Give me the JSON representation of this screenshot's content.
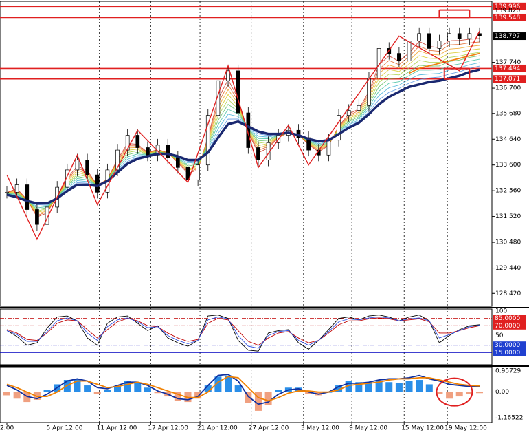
{
  "chart_data": [
    {
      "panel": "price",
      "type": "line",
      "ylim": [
        127.9,
        140.2
      ],
      "y_ticks": [
        128.42,
        129.44,
        130.48,
        131.52,
        132.56,
        133.6,
        134.64,
        135.68,
        136.7,
        137.74
      ],
      "y_tick_labels": [
        "128.420",
        "129.440",
        "130.480",
        "131.520",
        "132.560",
        "133.600",
        "134.640",
        "135.680",
        "136.700",
        "137.740"
      ],
      "price_tags": [
        {
          "label": "139.996",
          "value": 139.996,
          "style": "red"
        },
        {
          "label": "139.820",
          "value": 139.82,
          "style": "partial"
        },
        {
          "label": "139.548",
          "value": 139.548,
          "style": "red"
        },
        {
          "label": "138.797",
          "value": 138.797,
          "style": "black"
        },
        {
          "label": "137.494",
          "value": 137.494,
          "style": "red"
        },
        {
          "label": "137.071",
          "value": 137.071,
          "style": "red"
        }
      ],
      "x_range": [
        0,
        47
      ],
      "series": [
        {
          "key": "close",
          "color": "#000000",
          "x": [
            0,
            1,
            2,
            3,
            4,
            5,
            6,
            7,
            8,
            9,
            10,
            11,
            12,
            13,
            14,
            15,
            16,
            17,
            18,
            19,
            20,
            21,
            22,
            23,
            24,
            25,
            26,
            27,
            28,
            29,
            30,
            31,
            32,
            33,
            34,
            35,
            36,
            37,
            38,
            39,
            40,
            41,
            42,
            43,
            44,
            45,
            46,
            47
          ],
          "values": [
            132.5,
            132.8,
            131.8,
            131.2,
            131.9,
            132.7,
            133.4,
            133.8,
            133.2,
            132.5,
            133.4,
            134.2,
            134.8,
            134.3,
            134.0,
            134.4,
            133.9,
            133.5,
            133.0,
            133.6,
            135.6,
            137.0,
            137.4,
            135.7,
            134.3,
            133.8,
            134.5,
            134.8,
            135.0,
            134.7,
            134.2,
            134.0,
            134.6,
            135.6,
            135.8,
            136.0,
            137.1,
            138.3,
            138.1,
            137.8,
            138.6,
            138.9,
            138.3,
            138.6,
            138.9,
            138.7,
            138.9,
            138.8
          ]
        },
        {
          "key": "ma_slow",
          "color": "#1a2870",
          "x": [
            0,
            1,
            2,
            3,
            4,
            5,
            6,
            7,
            8,
            9,
            10,
            11,
            12,
            13,
            14,
            15,
            16,
            17,
            18,
            19,
            20,
            21,
            22,
            23,
            24,
            25,
            26,
            27,
            28,
            29,
            30,
            31,
            32,
            33,
            34,
            35,
            36,
            37,
            38,
            39,
            40,
            41,
            42,
            43,
            44,
            45,
            46,
            47
          ],
          "values": [
            132.4,
            132.3,
            132.15,
            132.05,
            132.05,
            132.25,
            132.55,
            132.8,
            132.8,
            132.75,
            132.95,
            133.3,
            133.65,
            133.85,
            133.95,
            134.05,
            134.05,
            133.95,
            133.8,
            133.8,
            134.1,
            134.7,
            135.25,
            135.35,
            135.15,
            134.95,
            134.85,
            134.85,
            134.9,
            134.8,
            134.65,
            134.55,
            134.6,
            134.85,
            135.1,
            135.3,
            135.65,
            136.05,
            136.35,
            136.55,
            136.75,
            136.85,
            136.95,
            137.0,
            137.1,
            137.2,
            137.35,
            137.45
          ]
        },
        {
          "key": "ma_orange",
          "color": "#f08010",
          "x": [
            40,
            41,
            42,
            43,
            44,
            45,
            46,
            47
          ],
          "values": [
            137.3,
            137.5,
            137.6,
            137.7,
            137.8,
            137.9,
            138.0,
            138.1
          ]
        }
      ],
      "band_colors": [
        "#c83020",
        "#e06020",
        "#f0a020",
        "#d8c820",
        "#a8d040",
        "#60c060",
        "#40c0a0",
        "#40b0d8",
        "#5090e0"
      ],
      "zigzag_points": {
        "x": [
          0,
          3,
          7,
          9,
          13,
          18,
          22,
          25,
          28,
          30,
          39,
          45,
          47
        ],
        "values": [
          133.2,
          130.6,
          134.0,
          132.0,
          135.0,
          132.9,
          137.6,
          133.5,
          135.2,
          133.6,
          138.8,
          137.4,
          139.0
        ]
      },
      "annotation_boxes": [
        {
          "x_from": 43,
          "x_to": 46,
          "y_from": 139.55,
          "y_to": 139.85
        },
        {
          "x_from": 43.5,
          "x_to": 46,
          "y_from": 137.07,
          "y_to": 137.49
        }
      ],
      "x_tick_labels": [
        "2:00",
        "5 Apr 12:00",
        "11 Apr 12:00",
        "17 Apr 12:00",
        "21 Apr 12:00",
        "27 Apr 12:00",
        "3 May 12:00",
        "9 May 12:00",
        "15 May 12:00",
        "19 May 12:00"
      ],
      "x_tick_positions": [
        0,
        4.2,
        9.2,
        14.3,
        19.2,
        24.3,
        29.5,
        34.3,
        39.5,
        43.8
      ]
    },
    {
      "panel": "stochastic",
      "type": "line",
      "ylim": [
        0,
        100
      ],
      "y_ticks": [
        100,
        85,
        70,
        50,
        30,
        15
      ],
      "y_tick_labels": [
        "100",
        "85.0000",
        "70.0000",
        "50",
        "30.0000",
        "15.0000"
      ],
      "levels": [
        {
          "value": 85,
          "color": "#c00000",
          "style": "dashdot"
        },
        {
          "value": 70,
          "color": "#c00000",
          "style": "dashdot"
        },
        {
          "value": 30,
          "color": "#0000c0",
          "style": "dashdot"
        },
        {
          "value": 15,
          "color": "#0000c0",
          "style": "solid"
        }
      ],
      "series": [
        {
          "key": "main",
          "color": "#000000",
          "x": [
            0,
            1,
            2,
            3,
            4,
            5,
            6,
            7,
            8,
            9,
            10,
            11,
            12,
            13,
            14,
            15,
            16,
            17,
            18,
            19,
            20,
            21,
            22,
            23,
            24,
            25,
            26,
            27,
            28,
            29,
            30,
            31,
            32,
            33,
            34,
            35,
            36,
            37,
            38,
            39,
            40,
            41,
            42,
            43,
            44,
            45,
            46,
            47
          ],
          "values": [
            60,
            48,
            30,
            35,
            65,
            88,
            90,
            80,
            45,
            30,
            75,
            88,
            90,
            75,
            60,
            70,
            45,
            35,
            28,
            40,
            90,
            92,
            85,
            40,
            20,
            18,
            55,
            60,
            62,
            35,
            22,
            40,
            62,
            85,
            88,
            82,
            90,
            92,
            88,
            80,
            88,
            92,
            80,
            35,
            50,
            62,
            70,
            72
          ]
        },
        {
          "key": "signal",
          "color": "#c00000",
          "x": [
            0,
            1,
            2,
            3,
            4,
            5,
            6,
            7,
            8,
            9,
            10,
            11,
            12,
            13,
            14,
            15,
            16,
            17,
            18,
            19,
            20,
            21,
            22,
            23,
            24,
            25,
            26,
            27,
            28,
            29,
            30,
            31,
            32,
            33,
            34,
            35,
            36,
            37,
            38,
            39,
            40,
            41,
            42,
            43,
            44,
            45,
            46,
            47
          ],
          "values": [
            62,
            55,
            42,
            40,
            55,
            75,
            82,
            80,
            62,
            45,
            62,
            78,
            85,
            80,
            70,
            68,
            55,
            45,
            38,
            42,
            75,
            85,
            82,
            60,
            38,
            30,
            45,
            55,
            58,
            45,
            35,
            40,
            55,
            72,
            80,
            80,
            84,
            86,
            84,
            80,
            82,
            84,
            78,
            55,
            55,
            60,
            66,
            70
          ]
        },
        {
          "key": "extra",
          "color": "#3050e0",
          "x": [
            0,
            1,
            2,
            3,
            4,
            5,
            6,
            7,
            8,
            9,
            10,
            11,
            12,
            13,
            14,
            15,
            16,
            17,
            18,
            19,
            20,
            21,
            22,
            23,
            24,
            25,
            26,
            27,
            28,
            29,
            30,
            31,
            32,
            33,
            34,
            35,
            36,
            37,
            38,
            39,
            40,
            41,
            42,
            43,
            44,
            45,
            46,
            47
          ],
          "values": [
            60,
            52,
            38,
            38,
            58,
            80,
            86,
            80,
            55,
            40,
            68,
            82,
            86,
            78,
            66,
            68,
            50,
            40,
            33,
            40,
            82,
            88,
            84,
            50,
            28,
            24,
            50,
            58,
            60,
            40,
            30,
            40,
            58,
            78,
            84,
            82,
            86,
            88,
            86,
            80,
            84,
            86,
            80,
            45,
            52,
            60,
            68,
            71
          ]
        }
      ]
    },
    {
      "panel": "oscillator",
      "type": "bar",
      "ylim": [
        -1.16522,
        0.95729
      ],
      "y_ticks": [
        0.95729,
        0.0,
        -1.16522
      ],
      "y_tick_labels": [
        "0.95729",
        "0.00",
        "-1.16522"
      ],
      "histogram": {
        "x": [
          0,
          1,
          2,
          3,
          4,
          5,
          6,
          7,
          8,
          9,
          10,
          11,
          12,
          13,
          14,
          15,
          16,
          17,
          18,
          19,
          20,
          21,
          22,
          23,
          24,
          25,
          26,
          27,
          28,
          29,
          30,
          31,
          32,
          33,
          34,
          35,
          36,
          37,
          38,
          39,
          40,
          41,
          42,
          43,
          44,
          45,
          46,
          47
        ],
        "values": [
          -0.15,
          -0.3,
          -0.45,
          -0.35,
          0.1,
          0.35,
          0.55,
          0.6,
          0.3,
          -0.1,
          0.1,
          0.25,
          0.5,
          0.4,
          0.2,
          -0.05,
          -0.2,
          -0.4,
          -0.45,
          -0.3,
          0.3,
          0.7,
          0.75,
          0.3,
          -0.5,
          -0.85,
          -0.6,
          0.1,
          0.2,
          0.2,
          -0.1,
          -0.15,
          0.0,
          0.3,
          0.5,
          0.45,
          0.45,
          0.5,
          0.45,
          0.4,
          0.5,
          0.55,
          0.35,
          -0.1,
          -0.3,
          -0.2,
          -0.1,
          -0.05
        ],
        "positive_color": "#2a8ee8",
        "negative_color": "#f0a080"
      },
      "series": [
        {
          "key": "line_main",
          "color": "#1030a0",
          "x": [
            0,
            1,
            2,
            3,
            4,
            5,
            6,
            7,
            8,
            9,
            10,
            11,
            12,
            13,
            14,
            15,
            16,
            17,
            18,
            19,
            20,
            21,
            22,
            23,
            24,
            25,
            26,
            27,
            28,
            29,
            30,
            31,
            32,
            33,
            34,
            35,
            36,
            37,
            38,
            39,
            40,
            41,
            42,
            43,
            44,
            45,
            46,
            47
          ],
          "values": [
            0.3,
            0.1,
            -0.2,
            -0.3,
            -0.1,
            0.2,
            0.5,
            0.6,
            0.5,
            0.2,
            0.15,
            0.3,
            0.45,
            0.45,
            0.3,
            0.05,
            -0.1,
            -0.3,
            -0.35,
            -0.2,
            0.3,
            0.75,
            0.8,
            0.5,
            -0.2,
            -0.55,
            -0.45,
            -0.1,
            0.1,
            0.15,
            0.0,
            -0.1,
            0.0,
            0.25,
            0.4,
            0.4,
            0.45,
            0.55,
            0.6,
            0.6,
            0.65,
            0.75,
            0.6,
            0.5,
            0.35,
            0.3,
            0.25,
            0.25
          ]
        },
        {
          "key": "line_signal",
          "color": "#f08000",
          "x": [
            0,
            1,
            2,
            3,
            4,
            5,
            6,
            7,
            8,
            9,
            10,
            11,
            12,
            13,
            14,
            15,
            16,
            17,
            18,
            19,
            20,
            21,
            22,
            23,
            24,
            25,
            26,
            27,
            28,
            29,
            30,
            31,
            32,
            33,
            34,
            35,
            36,
            37,
            38,
            39,
            40,
            41,
            42,
            43,
            44,
            45,
            46,
            47
          ],
          "values": [
            0.35,
            0.2,
            0.0,
            -0.2,
            -0.2,
            0.0,
            0.3,
            0.5,
            0.5,
            0.35,
            0.2,
            0.25,
            0.35,
            0.45,
            0.35,
            0.2,
            0.05,
            -0.1,
            -0.25,
            -0.25,
            0.0,
            0.45,
            0.7,
            0.65,
            0.2,
            -0.25,
            -0.4,
            -0.25,
            -0.05,
            0.05,
            0.05,
            0.0,
            0.0,
            0.1,
            0.3,
            0.35,
            0.4,
            0.45,
            0.55,
            0.6,
            0.6,
            0.65,
            0.65,
            0.55,
            0.45,
            0.35,
            0.3,
            0.28
          ]
        }
      ],
      "annotation_circle": {
        "x": 44.5,
        "y": 0.0
      }
    }
  ]
}
